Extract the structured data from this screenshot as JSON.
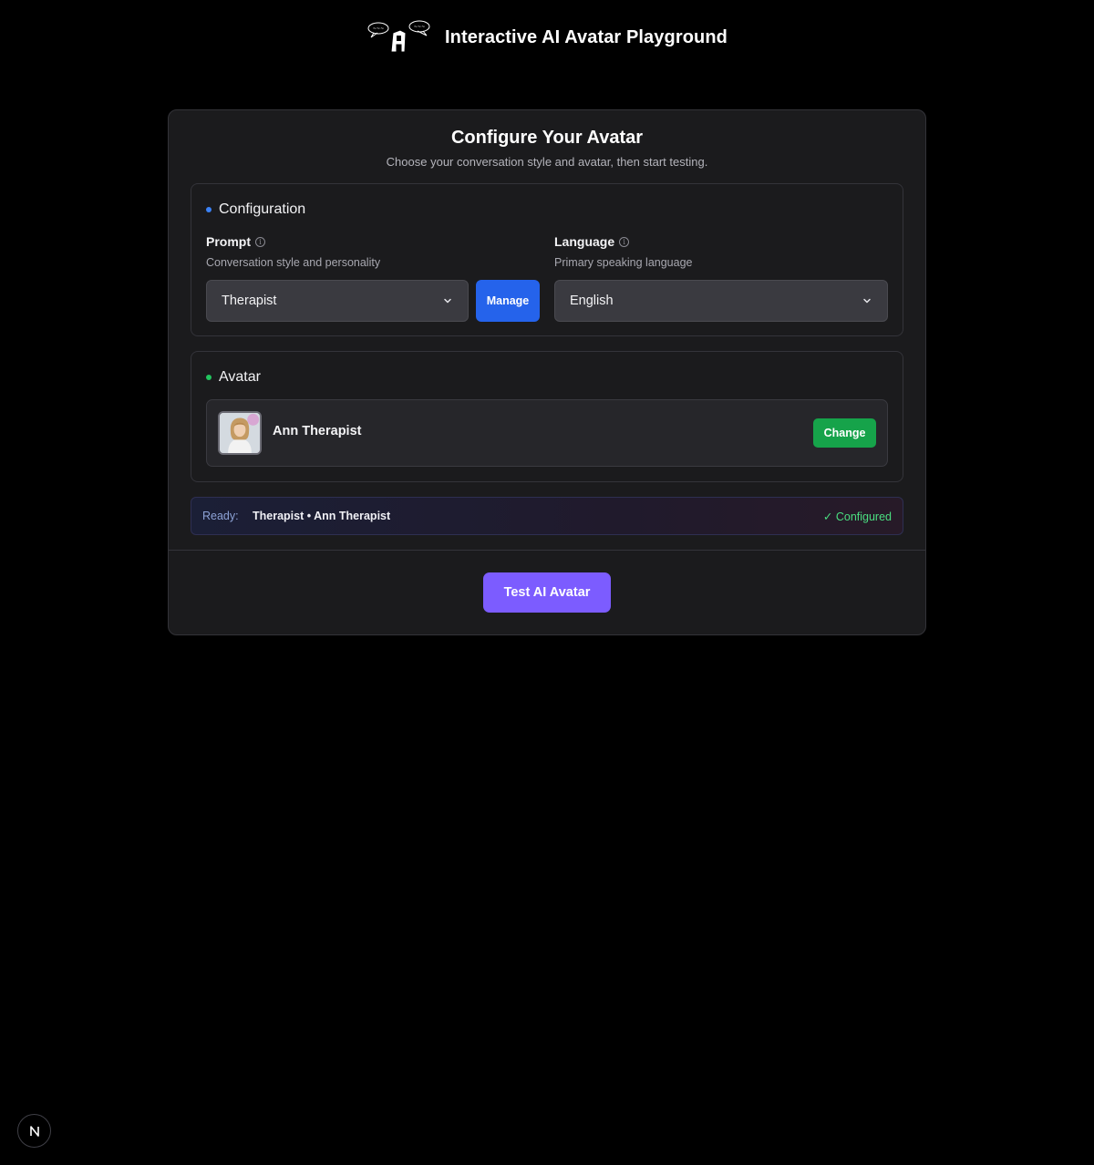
{
  "header": {
    "app_title": "Interactive AI Avatar Playground",
    "logo_icon": "speech-bubble-avatar-logo"
  },
  "card": {
    "title": "Configure Your Avatar",
    "subtitle": "Choose your conversation style and avatar, then start testing."
  },
  "configuration": {
    "section_title": "Configuration",
    "accent_color": "#3b82f6",
    "prompt": {
      "label": "Prompt",
      "help": "Conversation style and personality",
      "selected": "Therapist",
      "info_icon": "info-icon"
    },
    "manage_label": "Manage",
    "language": {
      "label": "Language",
      "help": "Primary speaking language",
      "selected": "English",
      "info_icon": "info-icon"
    }
  },
  "avatar": {
    "section_title": "Avatar",
    "accent_color": "#22c55e",
    "name": "Ann Therapist",
    "change_label": "Change"
  },
  "ready": {
    "label": "Ready:",
    "value": "Therapist • Ann Therapist",
    "status": "✓ Configured",
    "status_color": "#4ade80"
  },
  "actions": {
    "test_label": "Test AI Avatar",
    "test_color": "#7c5cff"
  },
  "badge": {
    "letter_icon": "n-logo-icon"
  }
}
